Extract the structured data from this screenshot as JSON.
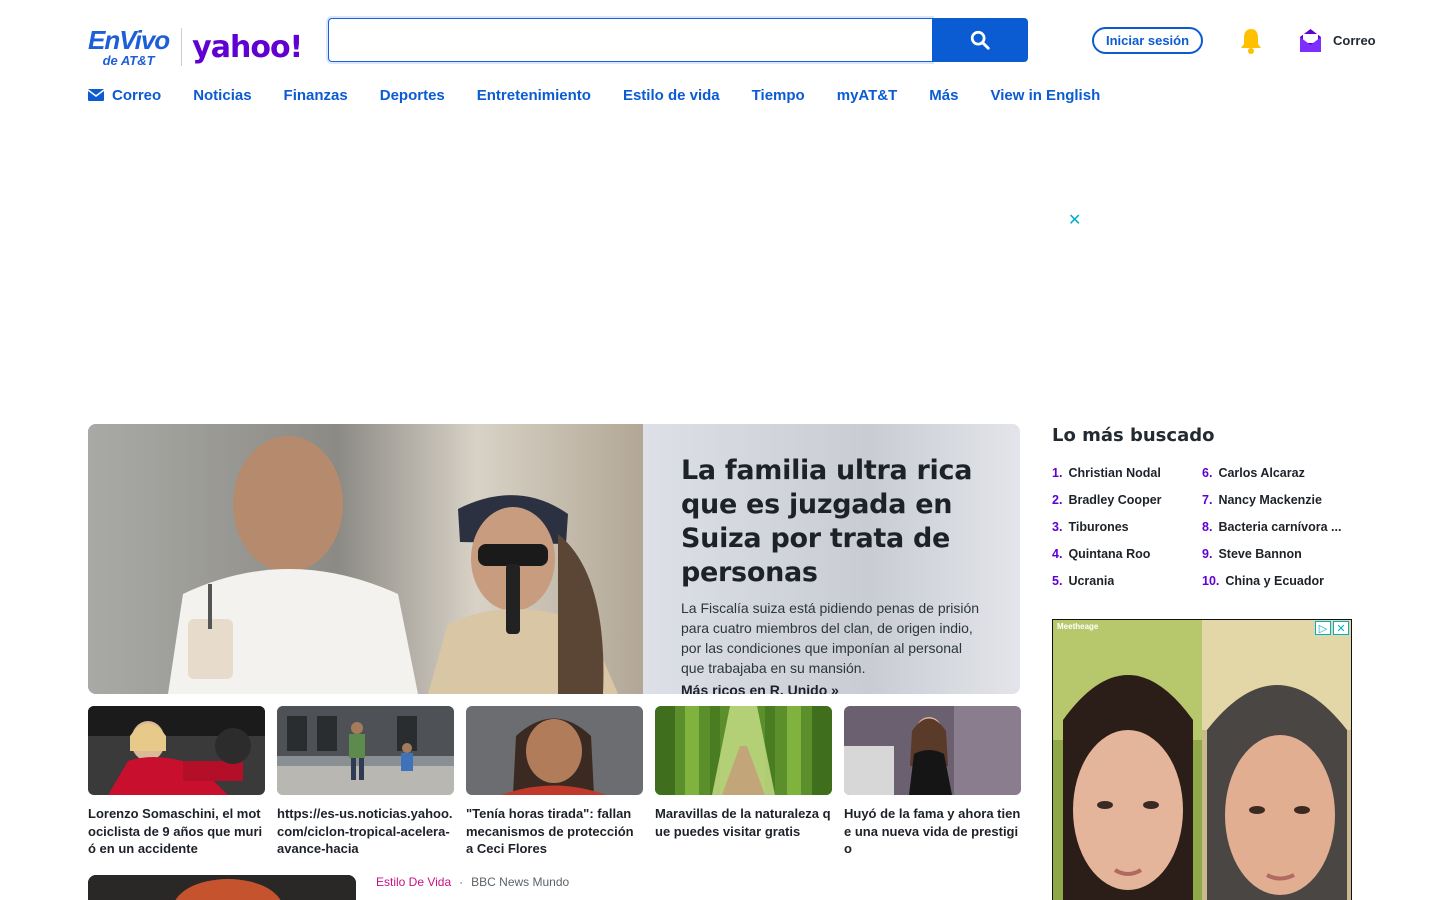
{
  "header": {
    "logo_envivo_line1": "EnVivo",
    "logo_envivo_line2": "de AT&T",
    "logo_yahoo": "yahoo!",
    "search_placeholder": "",
    "signin_label": "Iniciar sesión",
    "mail_label": "Correo"
  },
  "colors": {
    "brand_blue": "#0b5bd3",
    "yahoo_purple": "#6001d2",
    "category_pink": "#c8137f"
  },
  "nav": {
    "items": [
      {
        "label": "Correo",
        "icon": "mail-icon"
      },
      {
        "label": "Noticias"
      },
      {
        "label": "Finanzas"
      },
      {
        "label": "Deportes"
      },
      {
        "label": "Entretenimiento"
      },
      {
        "label": "Estilo de vida"
      },
      {
        "label": "Tiempo"
      },
      {
        "label": "myAT&T"
      },
      {
        "label": "Más"
      },
      {
        "label": "View in English"
      }
    ]
  },
  "ad": {
    "close_glyph": "✕"
  },
  "hero": {
    "title": "La familia ultra rica que es juzgada en Suiza por trata de personas",
    "summary": "La Fiscalía suiza está pidiendo penas de prisión para cuatro miembros del clan, de origen indio, por las condiciones que imponían al personal que trabajaba en su mansión.",
    "link": "Más ricos en R. Unido »"
  },
  "thumbs": [
    {
      "title": "Lorenzo Somaschini, el motociclista de 9 años que murió en un accidente"
    },
    {
      "title": "https://es-us.noticias.yahoo.com/ciclon-tropical-acelera-avance-hacia"
    },
    {
      "title": "\"Tenía horas tirada\": fallan mecanismos de protección a Ceci Flores"
    },
    {
      "title": "Maravillas de la naturaleza que puedes visitar gratis"
    },
    {
      "title": "Huyó de la fama y ahora tiene una nueva vida de prestigio"
    }
  ],
  "bottom_story": {
    "category": "Estilo De Vida",
    "separator": "·",
    "source": "BBC News Mundo"
  },
  "trending": {
    "title": "Lo más buscado",
    "items": [
      {
        "num": "1.",
        "label": "Christian Nodal"
      },
      {
        "num": "2.",
        "label": "Bradley Cooper"
      },
      {
        "num": "3.",
        "label": "Tiburones"
      },
      {
        "num": "4.",
        "label": "Quintana Roo"
      },
      {
        "num": "5.",
        "label": "Ucrania"
      },
      {
        "num": "6.",
        "label": "Carlos Alcaraz"
      },
      {
        "num": "7.",
        "label": "Nancy Mackenzie"
      },
      {
        "num": "8.",
        "label": "Bacteria carnívora ..."
      },
      {
        "num": "9.",
        "label": "Steve Bannon"
      },
      {
        "num": "10.",
        "label": "China y Ecuador"
      }
    ]
  },
  "side_ad": {
    "brand": "Meetheage",
    "play_glyph": "▷",
    "close_glyph": "✕"
  }
}
